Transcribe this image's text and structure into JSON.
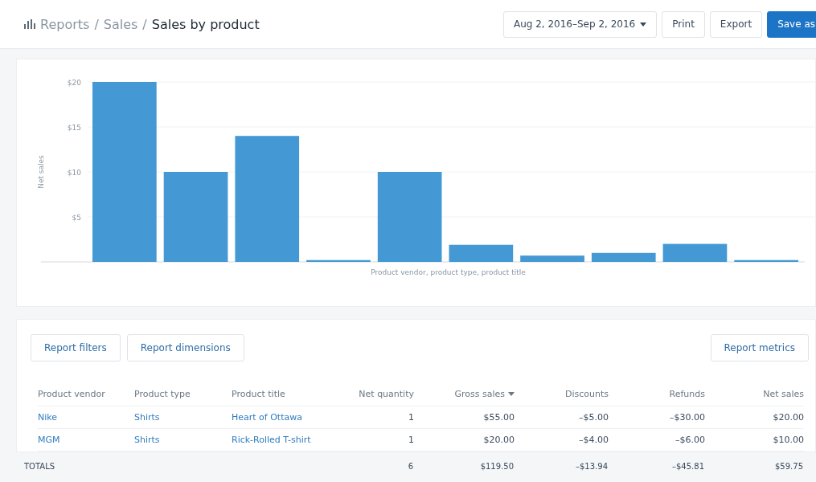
{
  "header": {
    "breadcrumb": [
      {
        "label": "Reports",
        "current": false
      },
      {
        "label": "Sales",
        "current": false
      },
      {
        "label": "Sales by product",
        "current": true
      }
    ],
    "separator": "/",
    "actions": [
      {
        "label": "Aug 2, 2016–Sep 2, 2016",
        "kind": "dropdown"
      },
      {
        "label": "Print",
        "kind": "default"
      },
      {
        "label": "Export",
        "kind": "default"
      },
      {
        "label": "Save as",
        "kind": "primary"
      }
    ]
  },
  "chart": {
    "chart_data": {
      "type": "bar",
      "xlabel": "Product vendor, product type, product title",
      "ylabel": "Net sales",
      "values": [
        20,
        10,
        14,
        0.2,
        10,
        1.9,
        0.7,
        1.0,
        2.0,
        0.2
      ],
      "color": "#4499d4",
      "grid": true,
      "ylim": [
        0,
        20
      ],
      "yticks": [
        {
          "value": 5,
          "label": "$5"
        },
        {
          "value": 10,
          "label": "$10"
        },
        {
          "value": 15,
          "label": "$15"
        },
        {
          "value": 20,
          "label": "$20"
        }
      ]
    }
  },
  "report": {
    "left_buttons": [
      "Report filters",
      "Report dimensions"
    ],
    "right_buttons": [
      "Report metrics"
    ],
    "columns": [
      {
        "label": "Product vendor",
        "kind": "text",
        "sorted": false
      },
      {
        "label": "Product type",
        "kind": "text",
        "sorted": false
      },
      {
        "label": "Product title",
        "kind": "text",
        "sorted": false
      },
      {
        "label": "Net quantity",
        "kind": "number",
        "sorted": false
      },
      {
        "label": "Gross sales",
        "kind": "number",
        "sorted": true
      },
      {
        "label": "Discounts",
        "kind": "number",
        "sorted": false
      },
      {
        "label": "Refunds",
        "kind": "number",
        "sorted": false
      },
      {
        "label": "Net sales",
        "kind": "number",
        "sorted": false
      }
    ],
    "rows": [
      [
        "Nike",
        "Shirts",
        "Heart of Ottawa",
        "1",
        "$55.00",
        "–$5.00",
        "–$30.00",
        "$20.00"
      ],
      [
        "MGM",
        "Shirts",
        "Rick-Rolled T-shirt",
        "1",
        "$20.00",
        "–$4.00",
        "–$6.00",
        "$10.00"
      ]
    ],
    "totals": {
      "label": "TOTALS",
      "values": [
        "6",
        "$119.50",
        "–$13.94",
        "–$45.81",
        "$59.75"
      ]
    }
  }
}
